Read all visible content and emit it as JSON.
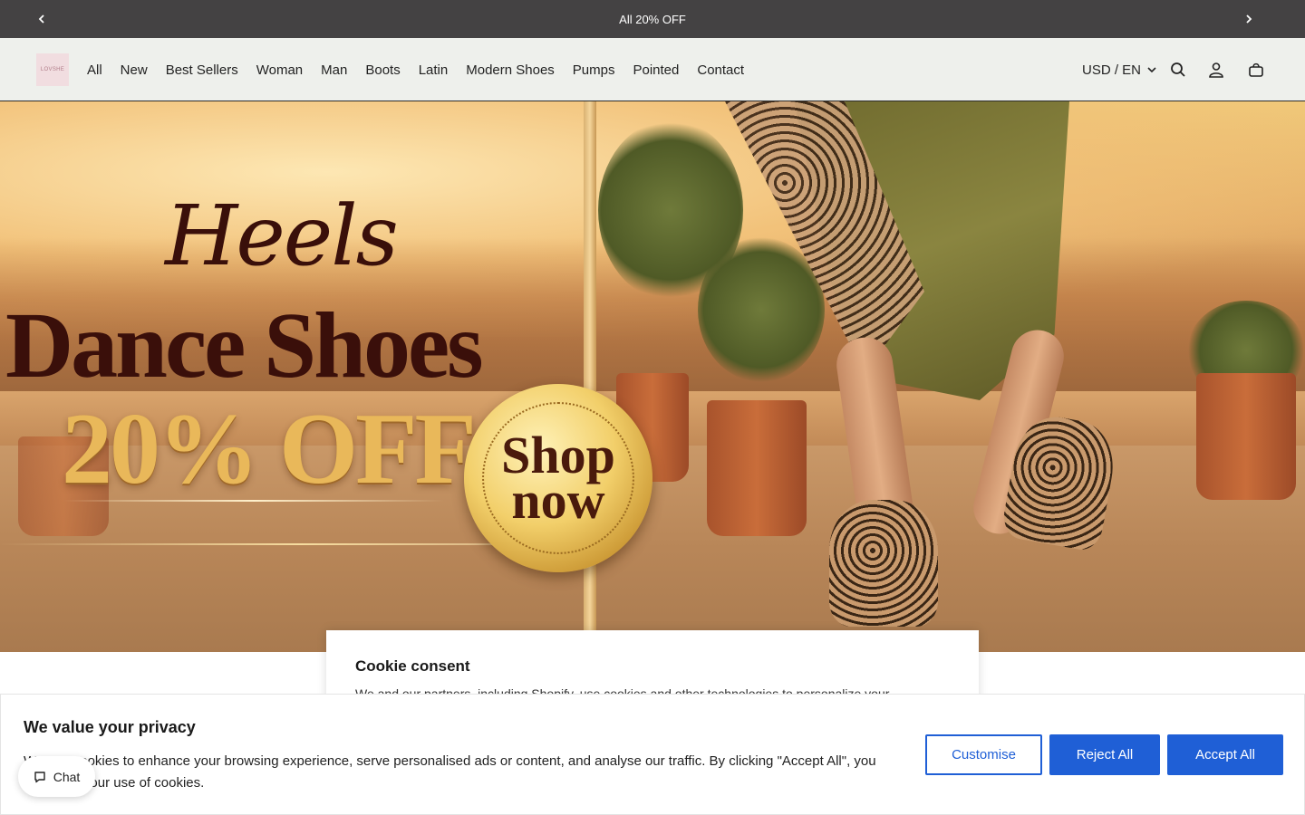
{
  "announcement": {
    "text": "All 20% OFF",
    "prev_icon": "chevron-left-icon",
    "next_icon": "chevron-right-icon"
  },
  "header": {
    "logo_text": "LOVSHE",
    "nav": [
      "All",
      "New",
      "Best Sellers",
      "Woman",
      "Man",
      "Boots",
      "Latin",
      "Modern Shoes",
      "Pumps",
      "Pointed",
      "Contact"
    ],
    "currency": "USD / EN",
    "icons": [
      "search-icon",
      "account-icon",
      "cart-icon"
    ]
  },
  "hero": {
    "title": "Heels",
    "subtitle": "Dance Shoes",
    "discount": "20% OFF",
    "cta_line1": "Shop",
    "cta_line2": "now"
  },
  "cookie_consent": {
    "title": "Cookie consent",
    "text": "We and our partners, including Shopify, use cookies and other technologies to personalize your"
  },
  "privacy_banner": {
    "title": "We value your privacy",
    "text": "We use cookies to enhance your browsing experience, serve personalised ads or content, and analyse our traffic. By clicking \"Accept All\", you consent to our use of cookies.",
    "buttons": {
      "customise": "Customise",
      "reject": "Reject All",
      "accept": "Accept All"
    },
    "accent_color": "#1f5fd6"
  },
  "chat": {
    "label": "Chat"
  }
}
